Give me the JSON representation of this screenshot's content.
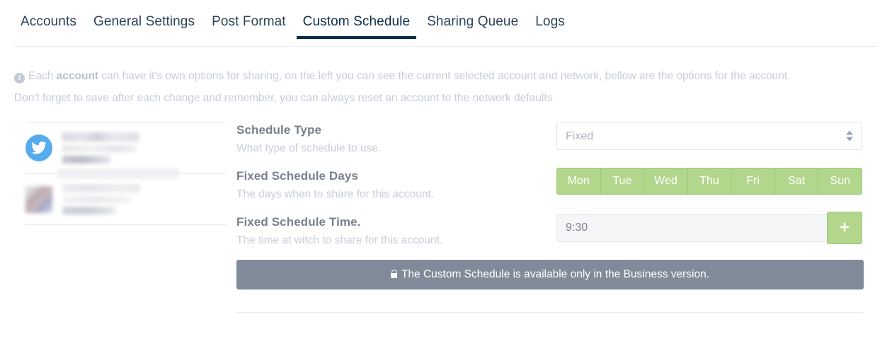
{
  "tabs": [
    {
      "label": "Accounts",
      "active": false
    },
    {
      "label": "General Settings",
      "active": false
    },
    {
      "label": "Post Format",
      "active": false
    },
    {
      "label": "Custom Schedule",
      "active": true
    },
    {
      "label": "Sharing Queue",
      "active": false
    },
    {
      "label": "Logs",
      "active": false
    }
  ],
  "notice": {
    "icon": "info-icon",
    "line1_pre": "Each ",
    "line1_bold": "account",
    "line1_post": " can have it's own options for sharing, on the left you can see the current selected account and network, bellow are the options for the account.",
    "line2": "Don't forget to save after each change and remember, you can always reset an account to the network defaults."
  },
  "sidebar": {
    "accounts": [
      {
        "avatar": "twitter-icon",
        "name_redacted": true
      },
      {
        "avatar": "blurred-avatar-image",
        "name_redacted": true
      }
    ]
  },
  "form": {
    "schedule_type": {
      "label": "Schedule Type",
      "description": "What type of schedule to use.",
      "value": "Fixed",
      "options": [
        "Fixed"
      ]
    },
    "schedule_days": {
      "label": "Fixed Schedule Days",
      "description": "The days when to share for this account.",
      "days": [
        {
          "label": "Mon",
          "selected": true
        },
        {
          "label": "Tue",
          "selected": true
        },
        {
          "label": "Wed",
          "selected": true
        },
        {
          "label": "Thu",
          "selected": true
        },
        {
          "label": "Fri",
          "selected": true
        },
        {
          "label": "Sat",
          "selected": true
        },
        {
          "label": "Sun",
          "selected": true
        }
      ]
    },
    "schedule_time": {
      "label": "Fixed Schedule Time.",
      "description": "The time at witch to share for this account.",
      "value": "9:30",
      "add_label": "+"
    }
  },
  "business_notice": {
    "icon": "lock-icon",
    "text": "The Custom Schedule is available only in the Business version."
  },
  "colors": {
    "accent_green": "#b2d78c",
    "green_border": "#9dc779",
    "tab_active": "#0c2b44",
    "twitter_blue": "#54abee",
    "notice_bar": "#7f8b99",
    "label_gray": "#78808c",
    "muted": "#c9ced8"
  }
}
